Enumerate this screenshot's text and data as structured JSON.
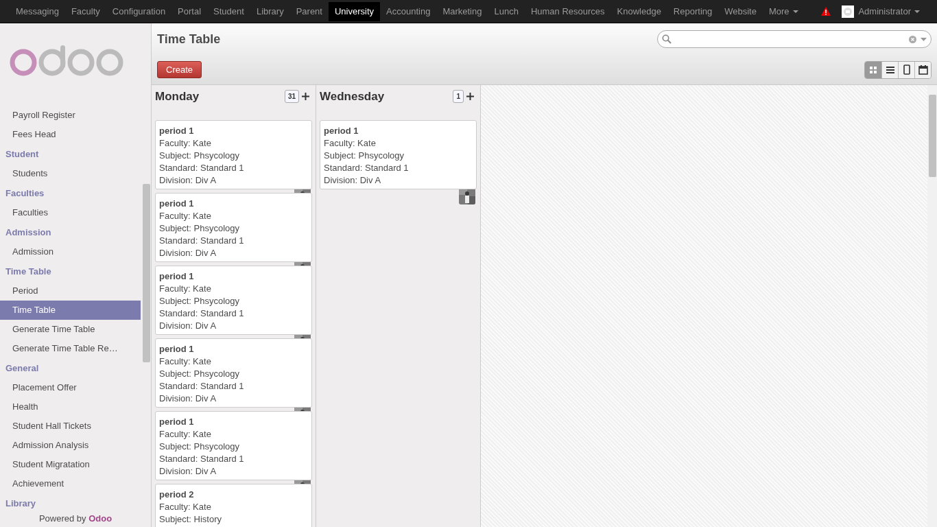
{
  "menu": [
    {
      "label": "Messaging",
      "selected": false
    },
    {
      "label": "Faculty",
      "selected": false
    },
    {
      "label": "Configuration",
      "selected": false
    },
    {
      "label": "Portal",
      "selected": false
    },
    {
      "label": "Student",
      "selected": false
    },
    {
      "label": "Library",
      "selected": false
    },
    {
      "label": "Parent",
      "selected": false
    },
    {
      "label": "University",
      "selected": true
    },
    {
      "label": "Accounting",
      "selected": false
    },
    {
      "label": "Marketing",
      "selected": false
    },
    {
      "label": "Lunch",
      "selected": false
    },
    {
      "label": "Human Resources",
      "selected": false
    },
    {
      "label": "Knowledge",
      "selected": false
    },
    {
      "label": "Reporting",
      "selected": false
    },
    {
      "label": "Website",
      "selected": false
    }
  ],
  "more": "More",
  "user": "Administrator",
  "sidebar": {
    "items": [
      {
        "kind": "item",
        "label": "Payroll Register",
        "selected": false
      },
      {
        "kind": "item",
        "label": "Fees Head",
        "selected": false
      },
      {
        "kind": "heading",
        "label": "Student"
      },
      {
        "kind": "item",
        "label": "Students",
        "selected": false
      },
      {
        "kind": "heading",
        "label": "Faculties"
      },
      {
        "kind": "item",
        "label": "Faculties",
        "selected": false
      },
      {
        "kind": "heading",
        "label": "Admission"
      },
      {
        "kind": "item",
        "label": "Admission",
        "selected": false
      },
      {
        "kind": "heading",
        "label": "Time Table"
      },
      {
        "kind": "item",
        "label": "Period",
        "selected": false
      },
      {
        "kind": "item",
        "label": "Time Table",
        "selected": true
      },
      {
        "kind": "item",
        "label": "Generate Time Table",
        "selected": false
      },
      {
        "kind": "item",
        "label": "Generate Time Table Re…",
        "selected": false
      },
      {
        "kind": "heading",
        "label": "General"
      },
      {
        "kind": "item",
        "label": "Placement Offer",
        "selected": false
      },
      {
        "kind": "item",
        "label": "Health",
        "selected": false
      },
      {
        "kind": "item",
        "label": "Student Hall Tickets",
        "selected": false
      },
      {
        "kind": "item",
        "label": "Admission Analysis",
        "selected": false
      },
      {
        "kind": "item",
        "label": "Student Migratation",
        "selected": false
      },
      {
        "kind": "item",
        "label": "Achievement",
        "selected": false
      },
      {
        "kind": "heading",
        "label": "Library"
      }
    ],
    "powered_by": "Powered by",
    "brand": "Odoo"
  },
  "title": "Time Table",
  "create_button": "Create",
  "views": [
    {
      "kind": "kanban",
      "selected": true
    },
    {
      "kind": "list",
      "selected": false
    },
    {
      "kind": "form",
      "selected": false
    },
    {
      "kind": "calendar",
      "selected": false
    }
  ],
  "columns": [
    {
      "title": "Monday",
      "count": "31",
      "cards": [
        {
          "title": "period 1",
          "lines": [
            "Faculty: Kate",
            "Subject: Phsycology",
            "Standard: Standard 1",
            "Division: Div A"
          ]
        },
        {
          "title": "period 1",
          "lines": [
            "Faculty: Kate",
            "Subject: Phsycology",
            "Standard: Standard 1",
            "Division: Div A"
          ]
        },
        {
          "title": "period 1",
          "lines": [
            "Faculty: Kate",
            "Subject: Phsycology",
            "Standard: Standard 1",
            "Division: Div A"
          ]
        },
        {
          "title": "period 1",
          "lines": [
            "Faculty: Kate",
            "Subject: Phsycology",
            "Standard: Standard 1",
            "Division: Div A"
          ]
        },
        {
          "title": "period 1",
          "lines": [
            "Faculty: Kate",
            "Subject: Phsycology",
            "Standard: Standard 1",
            "Division: Div A"
          ]
        },
        {
          "title": "period 2",
          "avatar": false,
          "lines": [
            "Faculty: Kate",
            "Subject: History"
          ]
        }
      ]
    },
    {
      "title": "Wednesday",
      "count": "1",
      "cards": [
        {
          "title": "period 1",
          "lines": [
            "Faculty: Kate",
            "Subject: Phsycology",
            "Standard: Standard 1",
            "Division: Div A"
          ]
        }
      ]
    }
  ]
}
